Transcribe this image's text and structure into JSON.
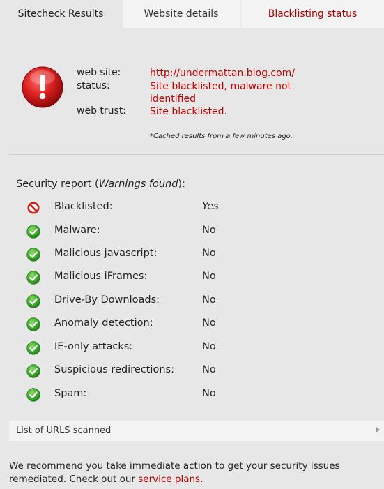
{
  "tabs": [
    {
      "label": "Sitecheck Results"
    },
    {
      "label": "Website details"
    },
    {
      "label": "Blacklisting status"
    }
  ],
  "summary": {
    "site_label": "web site:",
    "site_value": "http://undermattan.blog.com/",
    "status_label": "status:",
    "status_value": "Site blacklisted, malware not identified",
    "trust_label": "web trust:",
    "trust_value": "Site blacklisted.",
    "cached_note": "*Cached results from a few minutes ago."
  },
  "report": {
    "title_prefix": "Security report (",
    "title_warning": "Warnings found",
    "title_suffix": "):",
    "rows": [
      {
        "label": "Blacklisted:",
        "value": "Yes",
        "icon": "blocked-icon"
      },
      {
        "label": "Malware:",
        "value": "No",
        "icon": "check-icon"
      },
      {
        "label": "Malicious javascript:",
        "value": "No",
        "icon": "check-icon"
      },
      {
        "label": "Malicious iFrames:",
        "value": "No",
        "icon": "check-icon"
      },
      {
        "label": "Drive-By Downloads:",
        "value": "No",
        "icon": "check-icon"
      },
      {
        "label": "Anomaly detection:",
        "value": "No",
        "icon": "check-icon"
      },
      {
        "label": "IE-only attacks:",
        "value": "No",
        "icon": "check-icon"
      },
      {
        "label": "Suspicious redirections:",
        "value": "No",
        "icon": "check-icon"
      },
      {
        "label": "Spam:",
        "value": "No",
        "icon": "check-icon"
      }
    ]
  },
  "urls_bar": {
    "label": "List of URLS scanned"
  },
  "recommendation": {
    "text": "We recommend you take immediate action to get your security issues remediated. Check out our ",
    "link": "service plans."
  },
  "colors": {
    "accent_red": "#c00000",
    "check_green": "#4caf2f",
    "background": "#e7e7e7"
  }
}
